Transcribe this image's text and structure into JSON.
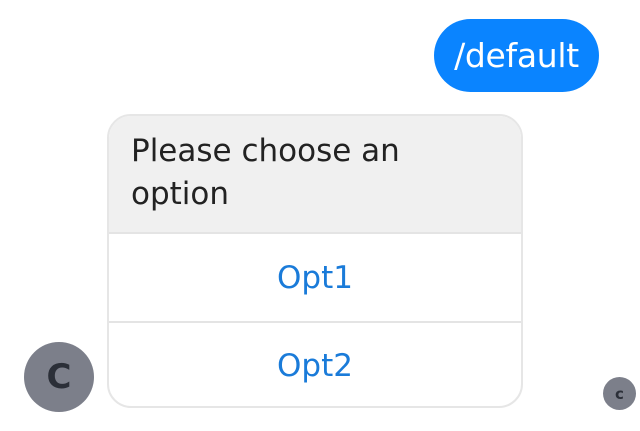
{
  "outgoing_message": {
    "text": "/default",
    "bubble_color": "#0a84ff"
  },
  "card": {
    "prompt": "Please choose an option",
    "options": [
      {
        "label": "Opt1"
      },
      {
        "label": "Opt2"
      }
    ],
    "option_color": "#1a7bd9"
  },
  "avatars": {
    "bot_initial": "C",
    "reader_initial": "c"
  }
}
